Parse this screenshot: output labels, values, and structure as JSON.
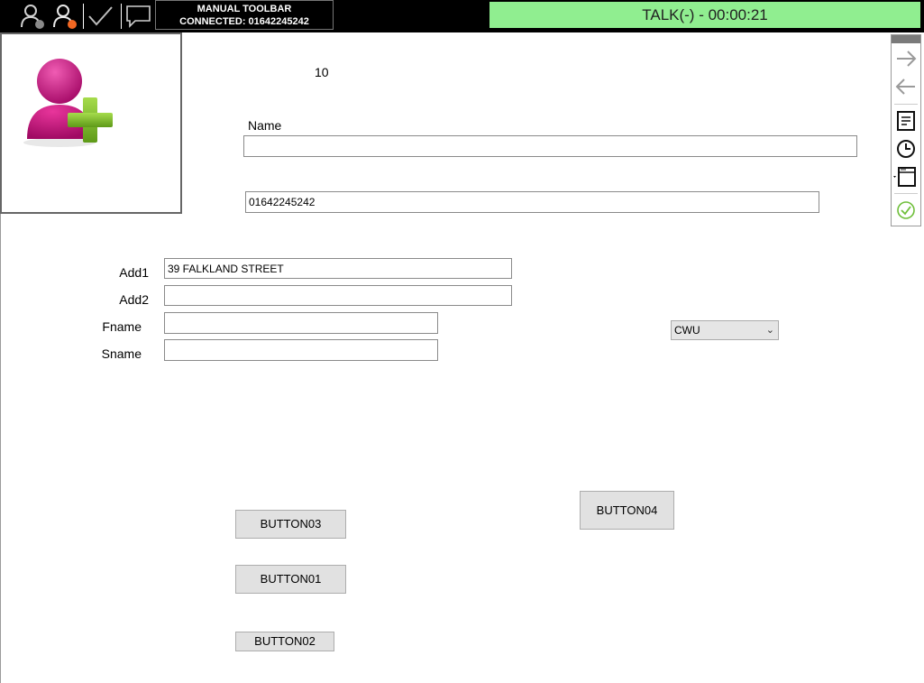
{
  "toolbar": {
    "icons": [
      "user-status-gray-icon",
      "user-status-orange-icon",
      "checkmark-icon",
      "chat-bubble-icon"
    ],
    "manual_title": "MANUAL TOOLBAR",
    "connected_text": "CONNECTED: 01642245242",
    "talk_status": "TALK(-) - 00:00:21",
    "talk_color": "#90ee90"
  },
  "form": {
    "record_number": "10",
    "name_label": "Name",
    "name_value": "",
    "phone_value": "01642245242",
    "add1_label": "Add1",
    "add1_value": "39 FALKLAND STREET",
    "add2_label": "Add2",
    "add2_value": "",
    "fname_label": "Fname",
    "fname_value": "",
    "sname_label": "Sname",
    "sname_value": "",
    "dropdown_selected": "CWU"
  },
  "buttons": {
    "button03": "BUTTON03",
    "button01": "BUTTON01",
    "button02": "BUTTON02",
    "button04": "BUTTON04"
  },
  "side_toolbar": {
    "icons": [
      "arrow-right-icon",
      "arrow-left-icon",
      "notes-icon",
      "clock-icon",
      "window-icon",
      "check-circle-icon"
    ]
  },
  "avatar": {
    "icon": "add-user-icon",
    "accent": "#c2127f",
    "plus_color": "#7fbf2a"
  }
}
